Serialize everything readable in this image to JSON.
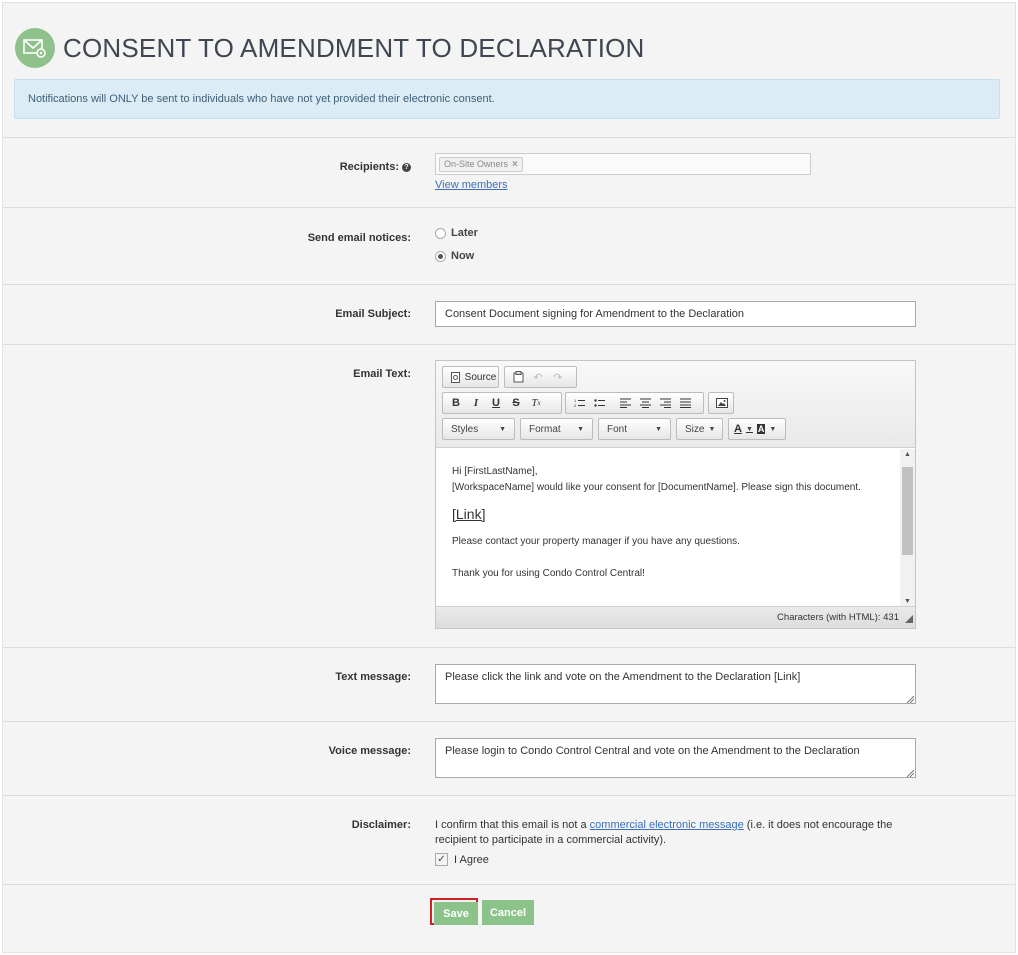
{
  "page": {
    "title": "CONSENT TO AMENDMENT TO DECLARATION",
    "notice": "Notifications will ONLY be sent to individuals who have not yet provided their electronic consent.",
    "icon": "envelope-gear-icon"
  },
  "recipients": {
    "label": "Recipients:",
    "tags": [
      "On-Site Owners"
    ],
    "view_members": "View members"
  },
  "send_notices": {
    "label": "Send email notices:",
    "options": [
      "Later",
      "Now"
    ],
    "selected": "Now"
  },
  "subject": {
    "label": "Email Subject:",
    "value": "Consent Document signing for Amendment to the Declaration"
  },
  "email_text": {
    "label": "Email Text:",
    "toolbar": {
      "source": "Source",
      "styles": "Styles",
      "format": "Format",
      "font": "Font",
      "size": "Size",
      "bold": "B",
      "italic": "I",
      "underline": "U",
      "strike": "S",
      "text_color": "A",
      "bg_color": "A"
    },
    "body": {
      "line1": "Hi [FirstLastName],",
      "line2": "[WorkspaceName] would like your consent for [DocumentName]. Please sign this document.",
      "link": "[Link]",
      "line3": "Please contact your property manager if you have any questions.",
      "line4": "Thank you for using Condo Control Central!"
    },
    "char_count": "Characters (with HTML): 431"
  },
  "text_message": {
    "label": "Text message:",
    "value": "Please click the link and vote on the Amendment to the Declaration [Link]"
  },
  "voice_message": {
    "label": "Voice message:",
    "value": "Please login to Condo Control Central and vote on the Amendment to the Declaration"
  },
  "disclaimer": {
    "label": "Disclaimer:",
    "text_before": "I confirm that this email is not a ",
    "link": "commercial electronic message",
    "text_after": " (i.e. it does not encourage the recipient to participate in a commercial activity).",
    "agree": "I Agree",
    "agreed": true
  },
  "actions": {
    "save": "Save",
    "cancel": "Cancel"
  },
  "colors": {
    "accent_green": "#8cc38a",
    "alert_bg": "#dcecf6",
    "highlight_red": "#d0202a"
  }
}
